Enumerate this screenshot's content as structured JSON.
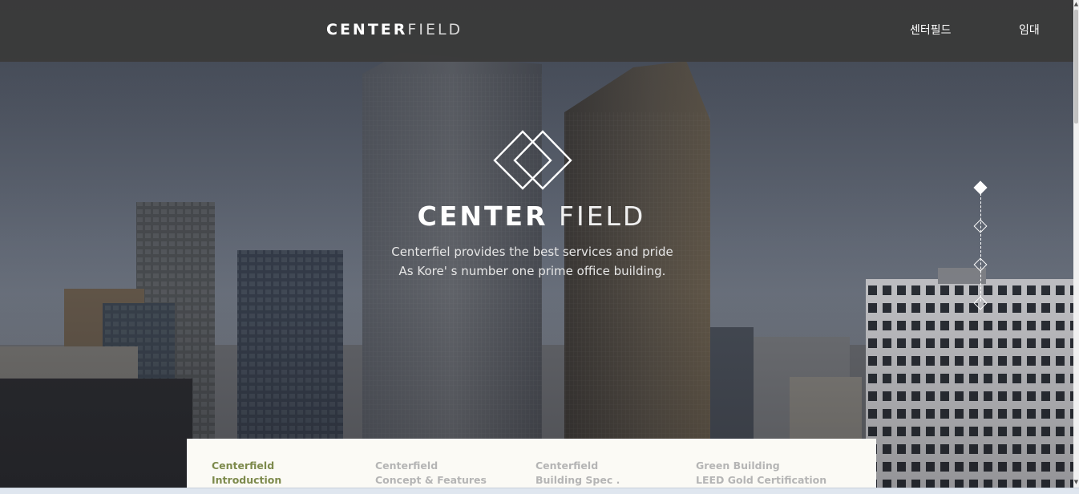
{
  "header": {
    "logo_bold": "CENTER",
    "logo_thin": "FIELD",
    "nav": [
      "센터필드",
      "임대"
    ]
  },
  "hero": {
    "title_bold": "CENTER",
    "title_thin": " FIELD",
    "tagline_line1": "Centerfiel provides the best services and pride",
    "tagline_line2": "As Kore' s number one prime office building."
  },
  "pager": {
    "total": 4,
    "active_index": 0
  },
  "tabs": [
    {
      "line1": "Centerfield",
      "line2": "Introduction",
      "active": true
    },
    {
      "line1": "Centerfield",
      "line2": "Concept & Features",
      "active": false
    },
    {
      "line1": "Centerfield",
      "line2": "Building Spec .",
      "active": false
    },
    {
      "line1": "Green Building",
      "line2": "LEED Gold Certification",
      "active": false
    }
  ],
  "colors": {
    "header_bg": "#3a3a3a",
    "tab_active": "#7d8a4c",
    "tab_inactive": "#b5b5b5",
    "panel_bg": "#fbfaf5"
  },
  "icons": [
    "centerfield-emblem-icon",
    "scroll-up-icon",
    "scroll-down-icon"
  ]
}
